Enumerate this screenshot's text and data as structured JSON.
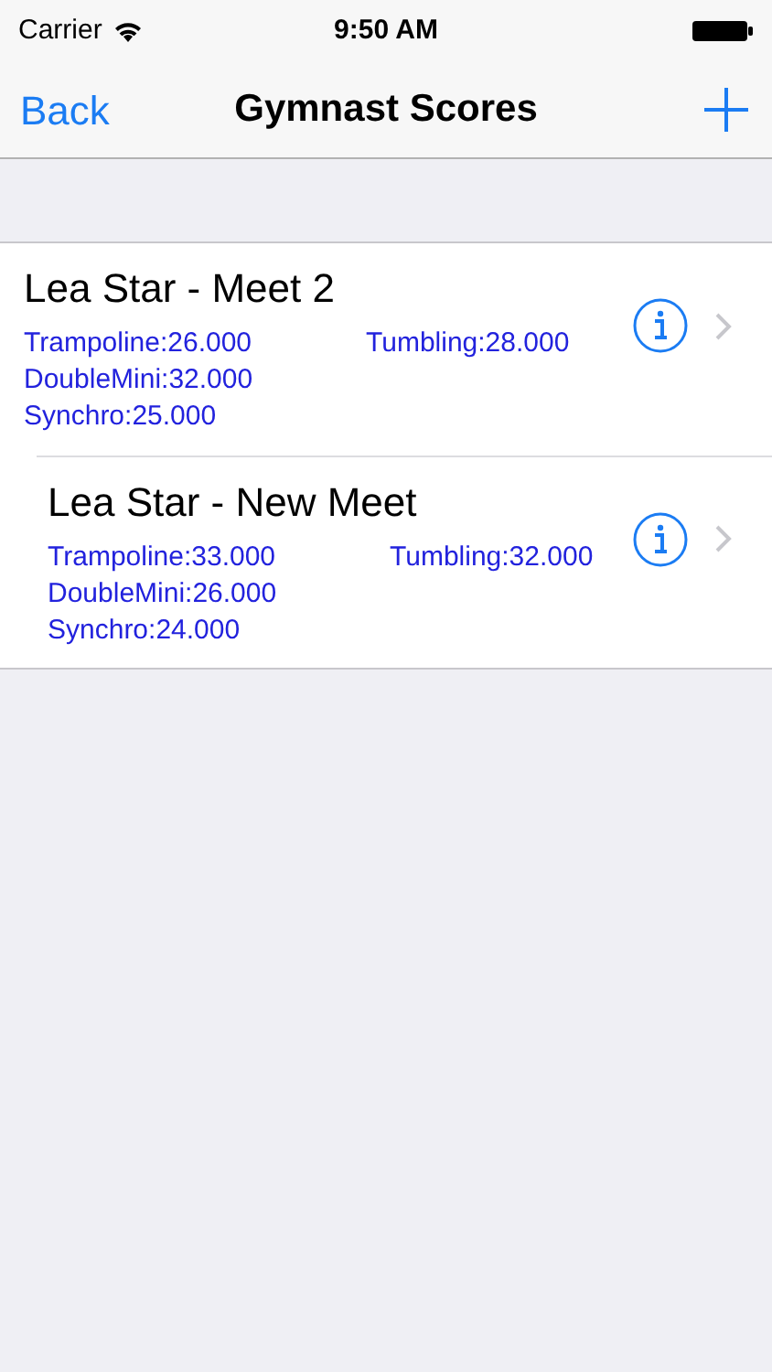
{
  "status_bar": {
    "carrier": "Carrier",
    "time": "9:50 AM"
  },
  "nav_bar": {
    "back": "Back",
    "title": "Gymnast Scores"
  },
  "rows": [
    {
      "title": "Lea Star - Meet 2",
      "scores": [
        "Trampoline:26.000",
        "Tumbling:28.000",
        "DoubleMini:32.000",
        "Synchro:25.000"
      ]
    },
    {
      "title": "Lea Star - New Meet",
      "scores": [
        "Trampoline:33.000",
        "Tumbling:32.000",
        "DoubleMini:26.000",
        "Synchro:24.000"
      ]
    }
  ]
}
